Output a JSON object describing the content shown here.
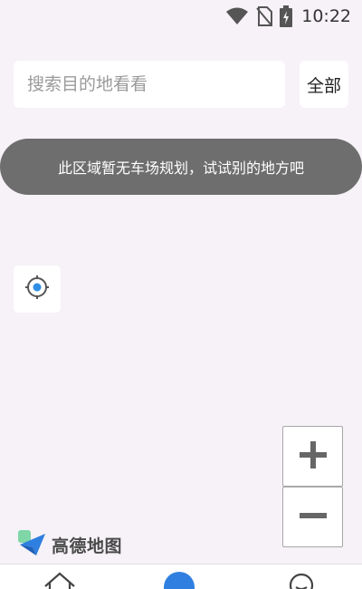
{
  "status_bar": {
    "time": "10:22",
    "icons": [
      "wifi-icon",
      "no-sim-icon",
      "battery-charging-icon"
    ]
  },
  "search": {
    "placeholder": "搜索目的地看看",
    "value": ""
  },
  "filter": {
    "all_label": "全部"
  },
  "toast": {
    "message": "此区域暂无车场规划，试试别的地方吧"
  },
  "map_controls": {
    "locate_icon": "locate-icon",
    "zoom_in_icon": "plus-icon",
    "zoom_out_icon": "minus-icon"
  },
  "map_logo": {
    "text": "高德地图",
    "icon": "amap-logo-icon"
  },
  "bottom_nav": {
    "items": [
      {
        "icon": "home-icon"
      },
      {
        "icon": "navigate-icon"
      },
      {
        "icon": "profile-icon"
      }
    ]
  },
  "colors": {
    "background": "#f6f2f7",
    "toast_bg": "#6e6e6e",
    "accent_blue": "#2f7fe0"
  }
}
